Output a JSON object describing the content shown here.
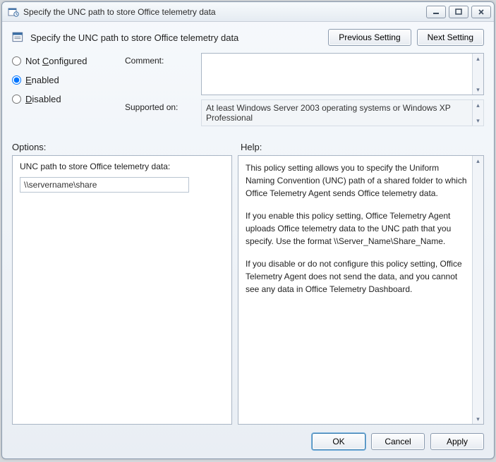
{
  "window": {
    "title": "Specify the UNC path to store Office telemetry data"
  },
  "header": {
    "title": "Specify the UNC path to store Office telemetry data",
    "prev": "Previous Setting",
    "next": "Next Setting"
  },
  "radios": {
    "not_configured": "Not Configured",
    "enabled": "Enabled",
    "disabled": "Disabled",
    "selected": "enabled"
  },
  "meta": {
    "comment_label": "Comment:",
    "comment_value": "",
    "supported_label": "Supported on:",
    "supported_value": "At least Windows Server 2003 operating systems or Windows XP Professional"
  },
  "panes": {
    "options_label": "Options:",
    "help_label": "Help:"
  },
  "options": {
    "field_label": "UNC path to store Office telemetry data:",
    "field_value": "\\\\servername\\share"
  },
  "help": {
    "p1": "This policy setting allows you to specify the Uniform Naming Convention (UNC) path of a shared folder to which Office Telemetry Agent sends Office telemetry data.",
    "p2": "If you enable this policy setting, Office Telemetry Agent uploads Office telemetry data to the UNC path that you specify. Use the format \\\\Server_Name\\Share_Name.",
    "p3": "If you disable or do not configure this policy setting, Office Telemetry Agent does not send the data, and you cannot see any data in Office Telemetry Dashboard."
  },
  "footer": {
    "ok": "OK",
    "cancel": "Cancel",
    "apply": "Apply"
  }
}
